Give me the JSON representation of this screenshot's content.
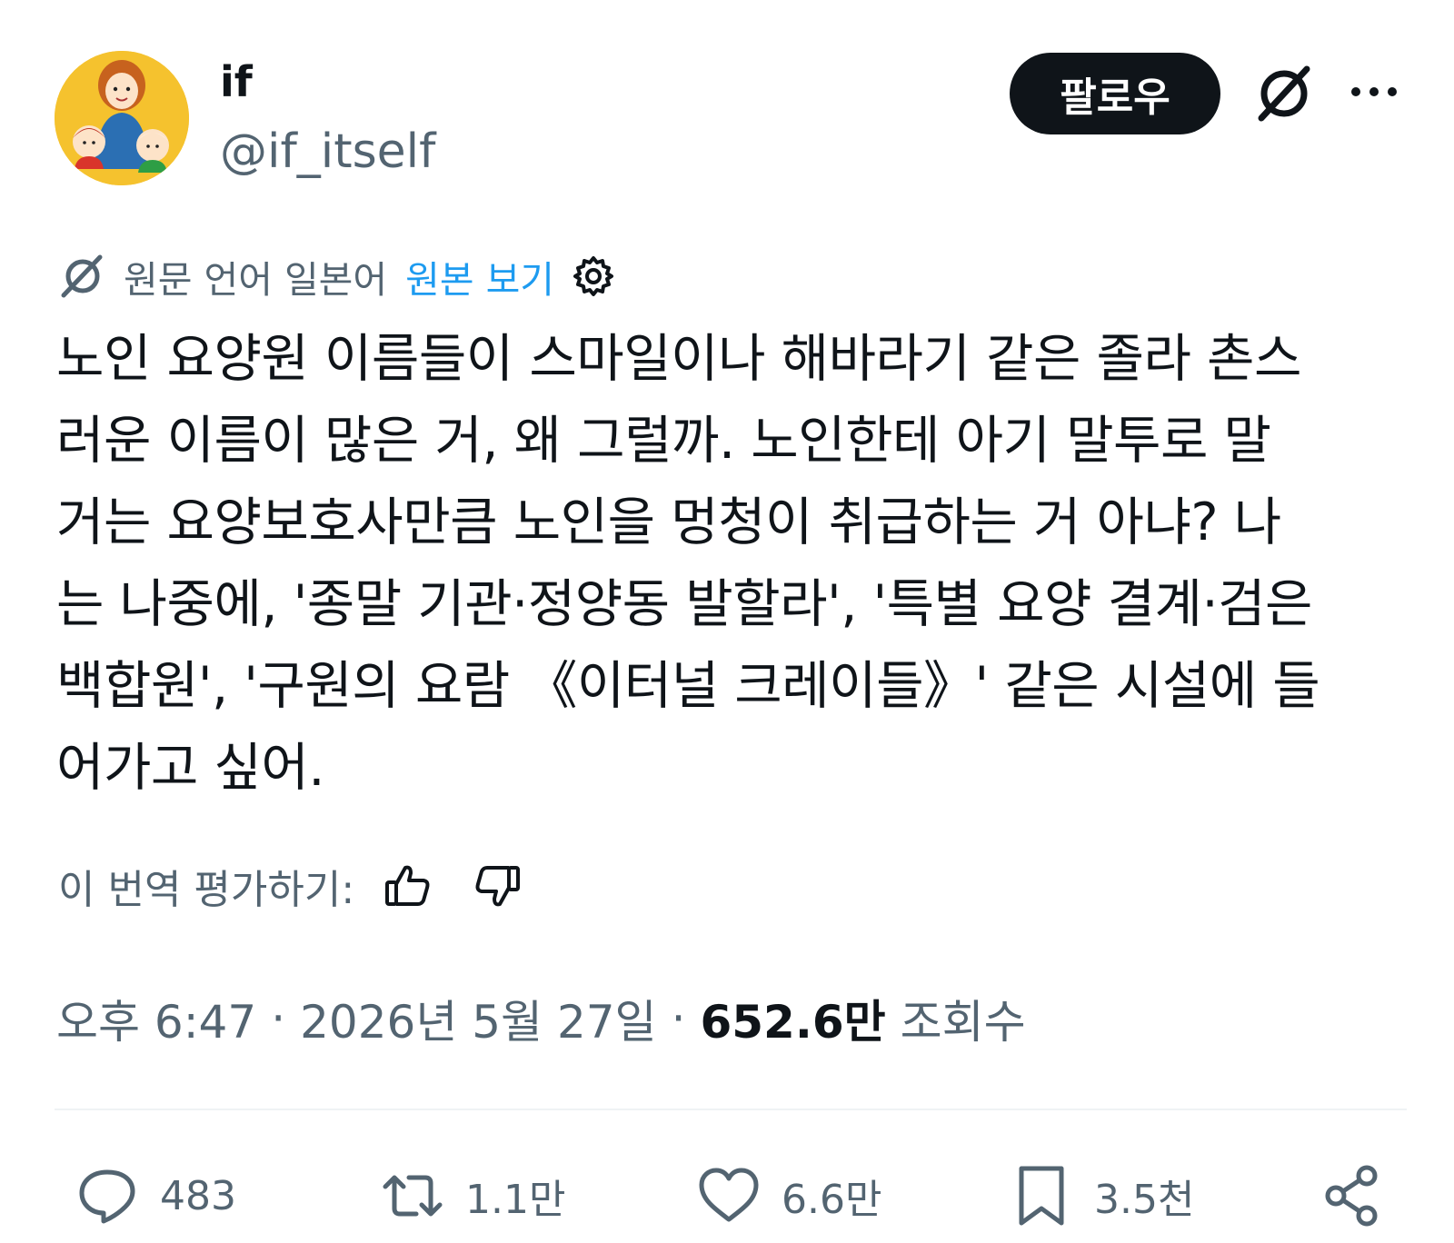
{
  "author": {
    "name": "if",
    "handle": "@if_itself"
  },
  "header": {
    "follow_label": "팔로우"
  },
  "translation": {
    "source_language": "원문 언어 일본어",
    "view_original": "원본 보기"
  },
  "tweet": {
    "text": "노인 요양원 이름들이 스마일이나 해바라기 같은 졸라 촌스\n러운 이름이 많은 거, 왜 그럴까. 노인한테 아기 말투로 말\n거는 요양보호사만큼 노인을 멍청이 취급하는 거 아냐? 나\n는 나중에, '종말 기관·정양동 발할라', '특별 요양 결계·검은\n백합원', '구원의 요람 《이터널 크레이들》' 같은 시설에 들\n어가고 싶어."
  },
  "rating": {
    "label": "이 번역 평가하기:"
  },
  "meta": {
    "time": "오후 6:47",
    "separator": "·",
    "date": "2026년 5월 27일",
    "views_count": "652.6만",
    "views_label": "조회수"
  },
  "actions": {
    "replies": "483",
    "retweets": "1.1만",
    "likes": "6.6만",
    "bookmarks": "3.5천"
  },
  "colors": {
    "text_primary": "#0f1419",
    "text_secondary": "#536471",
    "link": "#1d9bf0",
    "avatar_bg": "#f5c22e"
  }
}
